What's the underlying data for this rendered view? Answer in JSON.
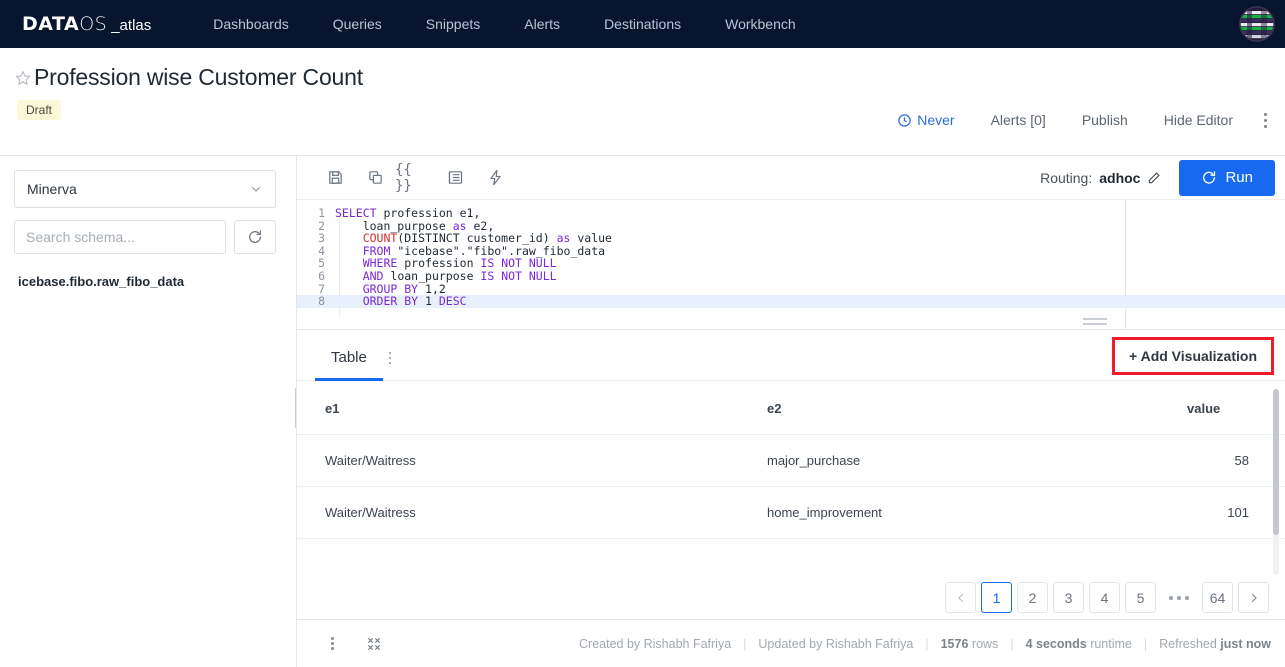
{
  "nav": {
    "logo": {
      "data": "DATA",
      "os": "OS",
      "atlas": "_atlas"
    },
    "links": [
      {
        "label": "Dashboards"
      },
      {
        "label": "Queries"
      },
      {
        "label": "Snippets"
      },
      {
        "label": "Alerts"
      },
      {
        "label": "Destinations"
      },
      {
        "label": "Workbench"
      }
    ],
    "avatar_icon": "user-avatar"
  },
  "header": {
    "star_icon": "star-outline-icon",
    "title": "Profession wise Customer Count",
    "badge": "Draft",
    "actions": {
      "schedule_icon": "clock-icon",
      "schedule": "Never",
      "alerts": "Alerts [0]",
      "publish": "Publish",
      "hide_editor": "Hide Editor",
      "more_icon": "kebab-menu-icon"
    }
  },
  "sidebar": {
    "datasource": {
      "value": "Minerva",
      "chevron_icon": "chevron-down-icon"
    },
    "search": {
      "placeholder": "Search schema...",
      "value": ""
    },
    "refresh_icon": "refresh-icon",
    "schemas": [
      "icebase.fibo.raw_fibo_data"
    ]
  },
  "editor": {
    "toolbar_icons": [
      "save-icon",
      "copy-icon",
      "braces-icon",
      "format-icon",
      "lightning-icon"
    ],
    "routing_label": "Routing:",
    "routing_value": "adhoc",
    "routing_edit_icon": "pencil-icon",
    "run_icon": "refresh-run-icon",
    "run_label": "Run",
    "active_line": 8,
    "lines": [
      {
        "n": "1",
        "tokens": [
          {
            "t": "SELECT",
            "c": "kw"
          },
          {
            "t": " profession e1,",
            "c": "plain"
          }
        ]
      },
      {
        "n": "2",
        "tokens": [
          {
            "t": "    loan_purpose ",
            "c": "plain"
          },
          {
            "t": "as",
            "c": "kw"
          },
          {
            "t": " e2,",
            "c": "plain"
          }
        ]
      },
      {
        "n": "3",
        "tokens": [
          {
            "t": "    ",
            "c": "plain"
          },
          {
            "t": "COUNT",
            "c": "fn"
          },
          {
            "t": "(DISTINCT customer_id) ",
            "c": "plain"
          },
          {
            "t": "as",
            "c": "kw"
          },
          {
            "t": " value",
            "c": "plain"
          }
        ]
      },
      {
        "n": "4",
        "tokens": [
          {
            "t": "    ",
            "c": "plain"
          },
          {
            "t": "FROM",
            "c": "kw"
          },
          {
            "t": " \"icebase\".\"fibo\".raw_fibo_data",
            "c": "plain"
          }
        ]
      },
      {
        "n": "5",
        "tokens": [
          {
            "t": "    ",
            "c": "plain"
          },
          {
            "t": "WHERE",
            "c": "kw"
          },
          {
            "t": " profession ",
            "c": "plain"
          },
          {
            "t": "IS NOT NULL",
            "c": "kw"
          }
        ]
      },
      {
        "n": "6",
        "tokens": [
          {
            "t": "    ",
            "c": "plain"
          },
          {
            "t": "AND",
            "c": "kw"
          },
          {
            "t": " loan_purpose ",
            "c": "plain"
          },
          {
            "t": "IS NOT NULL",
            "c": "kw"
          }
        ]
      },
      {
        "n": "7",
        "tokens": [
          {
            "t": "    ",
            "c": "plain"
          },
          {
            "t": "GROUP BY",
            "c": "kw"
          },
          {
            "t": " 1,2",
            "c": "plain"
          }
        ]
      },
      {
        "n": "8",
        "tokens": [
          {
            "t": "    ",
            "c": "plain"
          },
          {
            "t": "ORDER BY",
            "c": "kw"
          },
          {
            "t": " 1 ",
            "c": "plain"
          },
          {
            "t": "DESC",
            "c": "kw"
          }
        ]
      }
    ]
  },
  "results": {
    "tab_label": "Table",
    "tab_menu_icon": "kebab-menu-icon",
    "add_visualization": "+ Add Visualization",
    "columns": [
      "e1",
      "e2",
      "value"
    ],
    "rows": [
      {
        "e1": "Waiter/Waitress",
        "e2": "major_purchase",
        "value": "58"
      },
      {
        "e1": "Waiter/Waitress",
        "e2": "home_improvement",
        "value": "101"
      }
    ],
    "pagination": {
      "prev_icon": "chevron-left-icon",
      "next_icon": "chevron-right-icon",
      "pages": [
        "1",
        "2",
        "3",
        "4",
        "5"
      ],
      "ellipsis": "•••",
      "last_page": "64",
      "active": "1"
    }
  },
  "footer": {
    "menu_icon": "kebab-menu-icon",
    "expand_icon": "collapse-arrows-icon",
    "created_by": "Created by Rishabh Fafriya",
    "updated_by": "Updated by Rishabh Fafriya",
    "rows_count": "1576",
    "rows_label": "rows",
    "runtime_value": "4 seconds",
    "runtime_label": "runtime",
    "refreshed_label": "Refreshed",
    "refreshed_value": "just now"
  },
  "colors": {
    "nav_bg": "#07152e",
    "accent": "#1769f0",
    "highlight_outline": "#ee1c25",
    "badge_bg": "#fbf8d8"
  }
}
